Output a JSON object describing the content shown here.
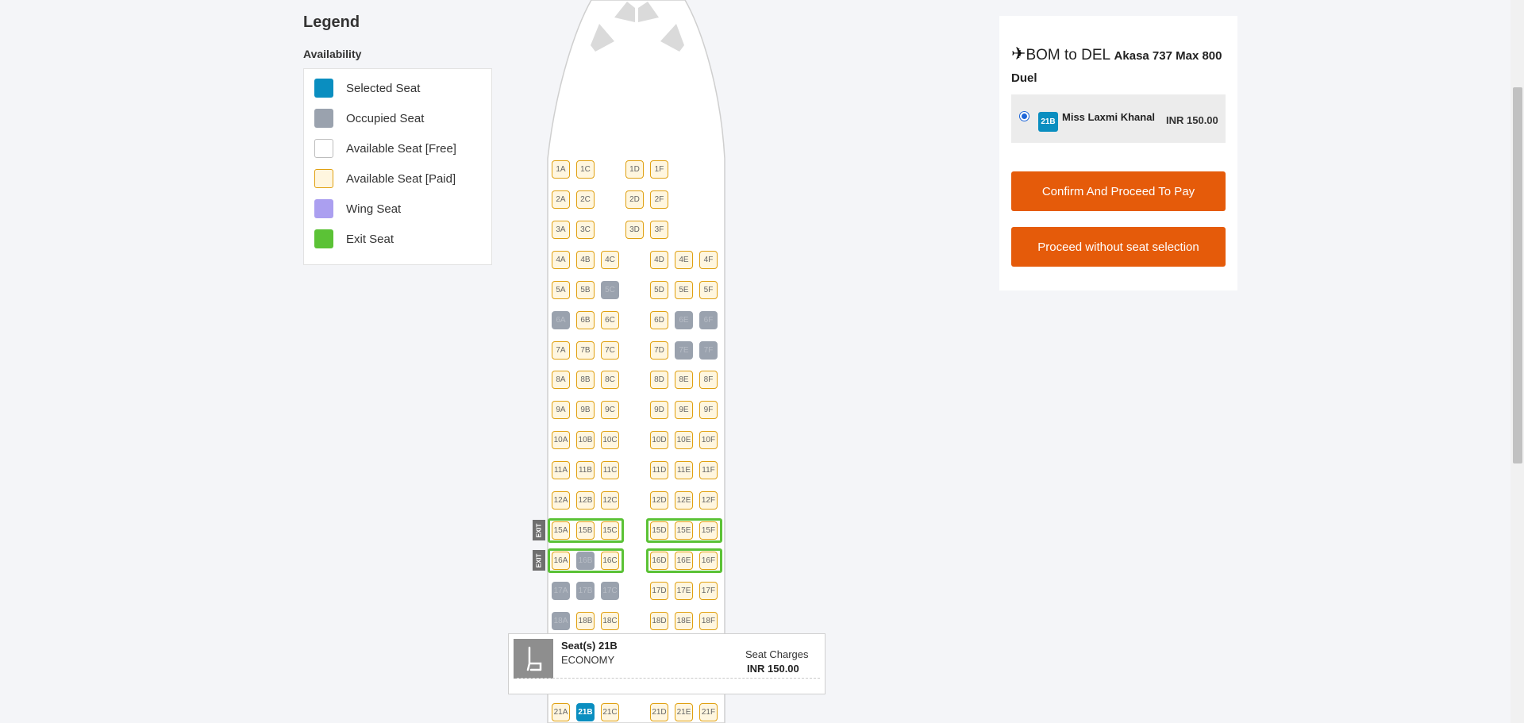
{
  "legend": {
    "title": "Legend",
    "subtitle": "Availability",
    "items": [
      {
        "label": "Selected Seat",
        "color": "#0a8ec0"
      },
      {
        "label": "Occupied Seat",
        "color": "#9aa2ae"
      },
      {
        "label": "Available Seat [Free]",
        "color": "#ffffff"
      },
      {
        "label": "Available Seat [Paid]",
        "color": "#fff6df"
      },
      {
        "label": "Wing Seat",
        "color": "#ab9ff0"
      },
      {
        "label": "Exit Seat",
        "color": "#5bc236"
      }
    ]
  },
  "seatmap": {
    "rows": [
      {
        "row": 1,
        "seats": [
          {
            "id": "1A",
            "status": "available"
          },
          {
            "id": "1C",
            "status": "available"
          },
          {
            "id": "1D",
            "status": "available"
          },
          {
            "id": "1F",
            "status": "available"
          }
        ]
      },
      {
        "row": 2,
        "seats": [
          {
            "id": "2A",
            "status": "available"
          },
          {
            "id": "2C",
            "status": "available"
          },
          {
            "id": "2D",
            "status": "available"
          },
          {
            "id": "2F",
            "status": "available"
          }
        ]
      },
      {
        "row": 3,
        "seats": [
          {
            "id": "3A",
            "status": "available"
          },
          {
            "id": "3C",
            "status": "available"
          },
          {
            "id": "3D",
            "status": "available"
          },
          {
            "id": "3F",
            "status": "available"
          }
        ]
      },
      {
        "row": 4,
        "seats": [
          {
            "id": "4A",
            "status": "available"
          },
          {
            "id": "4B",
            "status": "available"
          },
          {
            "id": "4C",
            "status": "available"
          },
          {
            "id": "4D",
            "status": "available"
          },
          {
            "id": "4E",
            "status": "available"
          },
          {
            "id": "4F",
            "status": "available"
          }
        ]
      },
      {
        "row": 5,
        "seats": [
          {
            "id": "5A",
            "status": "available"
          },
          {
            "id": "5B",
            "status": "available"
          },
          {
            "id": "5C",
            "status": "occupied"
          },
          {
            "id": "5D",
            "status": "available"
          },
          {
            "id": "5E",
            "status": "available"
          },
          {
            "id": "5F",
            "status": "available"
          }
        ]
      },
      {
        "row": 6,
        "seats": [
          {
            "id": "6A",
            "status": "occupied"
          },
          {
            "id": "6B",
            "status": "available"
          },
          {
            "id": "6C",
            "status": "available"
          },
          {
            "id": "6D",
            "status": "available"
          },
          {
            "id": "6E",
            "status": "occupied"
          },
          {
            "id": "6F",
            "status": "occupied"
          }
        ]
      },
      {
        "row": 7,
        "seats": [
          {
            "id": "7A",
            "status": "available"
          },
          {
            "id": "7B",
            "status": "available"
          },
          {
            "id": "7C",
            "status": "available"
          },
          {
            "id": "7D",
            "status": "available"
          },
          {
            "id": "7E",
            "status": "occupied"
          },
          {
            "id": "7F",
            "status": "occupied"
          }
        ]
      },
      {
        "row": 8,
        "seats": [
          {
            "id": "8A",
            "status": "available"
          },
          {
            "id": "8B",
            "status": "available"
          },
          {
            "id": "8C",
            "status": "available"
          },
          {
            "id": "8D",
            "status": "available"
          },
          {
            "id": "8E",
            "status": "available"
          },
          {
            "id": "8F",
            "status": "available"
          }
        ]
      },
      {
        "row": 9,
        "seats": [
          {
            "id": "9A",
            "status": "available"
          },
          {
            "id": "9B",
            "status": "available"
          },
          {
            "id": "9C",
            "status": "available"
          },
          {
            "id": "9D",
            "status": "available"
          },
          {
            "id": "9E",
            "status": "available"
          },
          {
            "id": "9F",
            "status": "available"
          }
        ]
      },
      {
        "row": 10,
        "seats": [
          {
            "id": "10A",
            "status": "available"
          },
          {
            "id": "10B",
            "status": "available"
          },
          {
            "id": "10C",
            "status": "available"
          },
          {
            "id": "10D",
            "status": "available"
          },
          {
            "id": "10E",
            "status": "available"
          },
          {
            "id": "10F",
            "status": "available"
          }
        ]
      },
      {
        "row": 11,
        "seats": [
          {
            "id": "11A",
            "status": "available"
          },
          {
            "id": "11B",
            "status": "available"
          },
          {
            "id": "11C",
            "status": "available"
          },
          {
            "id": "11D",
            "status": "available"
          },
          {
            "id": "11E",
            "status": "available"
          },
          {
            "id": "11F",
            "status": "available"
          }
        ]
      },
      {
        "row": 12,
        "seats": [
          {
            "id": "12A",
            "status": "available"
          },
          {
            "id": "12B",
            "status": "available"
          },
          {
            "id": "12C",
            "status": "available"
          },
          {
            "id": "12D",
            "status": "available"
          },
          {
            "id": "12E",
            "status": "available"
          },
          {
            "id": "12F",
            "status": "available"
          }
        ]
      },
      {
        "row": 15,
        "exit": true,
        "seats": [
          {
            "id": "15A",
            "status": "available"
          },
          {
            "id": "15B",
            "status": "available"
          },
          {
            "id": "15C",
            "status": "available"
          },
          {
            "id": "15D",
            "status": "available"
          },
          {
            "id": "15E",
            "status": "available"
          },
          {
            "id": "15F",
            "status": "available"
          }
        ]
      },
      {
        "row": 16,
        "exit": true,
        "seats": [
          {
            "id": "16A",
            "status": "available"
          },
          {
            "id": "16B",
            "status": "occupied"
          },
          {
            "id": "16C",
            "status": "available"
          },
          {
            "id": "16D",
            "status": "available"
          },
          {
            "id": "16E",
            "status": "available"
          },
          {
            "id": "16F",
            "status": "available"
          }
        ]
      },
      {
        "row": 17,
        "seats": [
          {
            "id": "17A",
            "status": "occupied"
          },
          {
            "id": "17B",
            "status": "occupied"
          },
          {
            "id": "17C",
            "status": "occupied"
          },
          {
            "id": "17D",
            "status": "available"
          },
          {
            "id": "17E",
            "status": "available"
          },
          {
            "id": "17F",
            "status": "available"
          }
        ]
      },
      {
        "row": 18,
        "seats": [
          {
            "id": "18A",
            "status": "occupied"
          },
          {
            "id": "18B",
            "status": "available"
          },
          {
            "id": "18C",
            "status": "available"
          },
          {
            "id": "18D",
            "status": "available"
          },
          {
            "id": "18E",
            "status": "available"
          },
          {
            "id": "18F",
            "status": "available"
          }
        ]
      },
      {
        "row": 21,
        "seats": [
          {
            "id": "21A",
            "status": "available"
          },
          {
            "id": "21B",
            "status": "selected"
          },
          {
            "id": "21C",
            "status": "available"
          },
          {
            "id": "21D",
            "status": "available"
          },
          {
            "id": "21E",
            "status": "available"
          },
          {
            "id": "21F",
            "status": "available"
          }
        ]
      }
    ],
    "exit_label": "EXIT"
  },
  "popup": {
    "seat_text": "Seat(s) 21B",
    "class_text": "ECONOMY",
    "charges_label": "Seat Charges",
    "charges_value": "INR 150.00"
  },
  "booking": {
    "route": "BOM to DEL",
    "aircraft": "Akasa 737 Max 800 Duel",
    "passenger": {
      "seat": "21B",
      "name": "Miss Laxmi Khanal",
      "price": "INR 150.00"
    },
    "confirm_label": "Confirm And Proceed To Pay",
    "skip_label": "Proceed without seat selection"
  },
  "colors": {
    "accent_button": "#e55b0a",
    "selected": "#0a8ec0",
    "occupied": "#9aa2ae",
    "paid": "#fff6df",
    "exit": "#5bc236"
  }
}
